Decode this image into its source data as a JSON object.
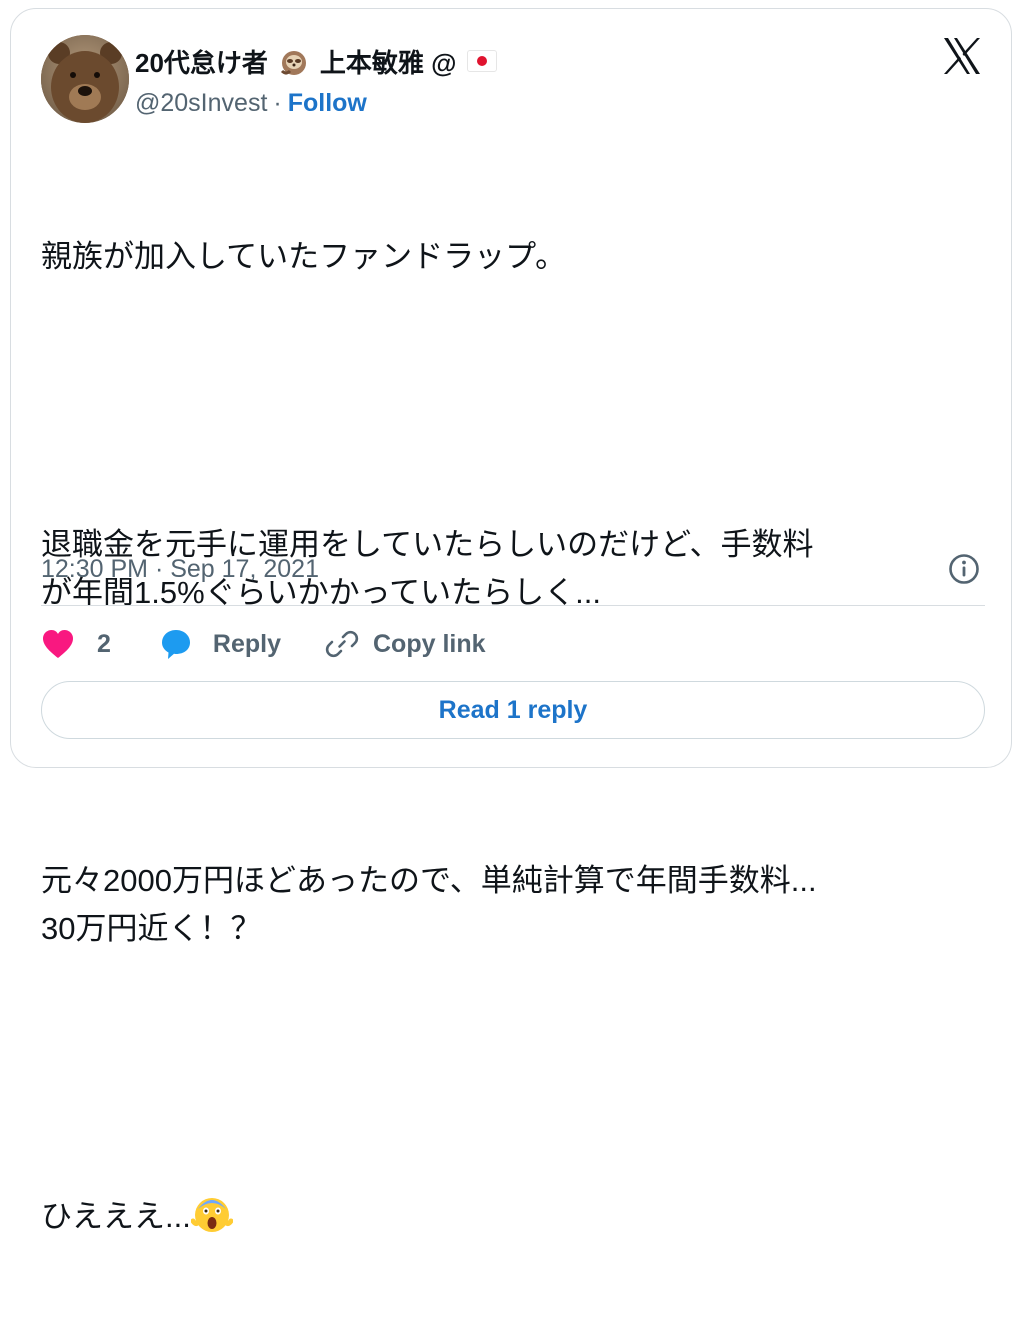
{
  "author": {
    "display_name": "20代怠け者",
    "display_name_suffix": "上本敏雅 @",
    "handle": "@20sInvest",
    "separator": "·",
    "follow_label": "Follow",
    "avatar_icon": "bear-avatar",
    "emoji_icons": [
      "sloth-icon",
      "japan-flag-icon"
    ]
  },
  "platform_logo": "x-logo-icon",
  "tweet": {
    "paragraphs": [
      "親族が加入していたファンドラップ。",
      "退職金を元手に運用をしていたらしいのだけど、手数料\nが年間1.5%ぐらいかかっていたらしく...",
      "元々2000万円ほどあったので、単純計算で年間手数料...\n30万円近く！？",
      "ひえええ..."
    ],
    "trailing_emoji": "screaming-face-icon"
  },
  "meta": {
    "timestamp": "12:30 PM · Sep 17, 2021",
    "info_icon": "info-icon"
  },
  "actions": {
    "like_count": "2",
    "reply_label": "Reply",
    "copy_link_label": "Copy link"
  },
  "read_replies_label": "Read 1 reply",
  "colors": {
    "like": "#f91880",
    "reply": "#1d9bf0",
    "link": "#1d74c9",
    "muted": "#536471",
    "border": "#d8dde1"
  }
}
